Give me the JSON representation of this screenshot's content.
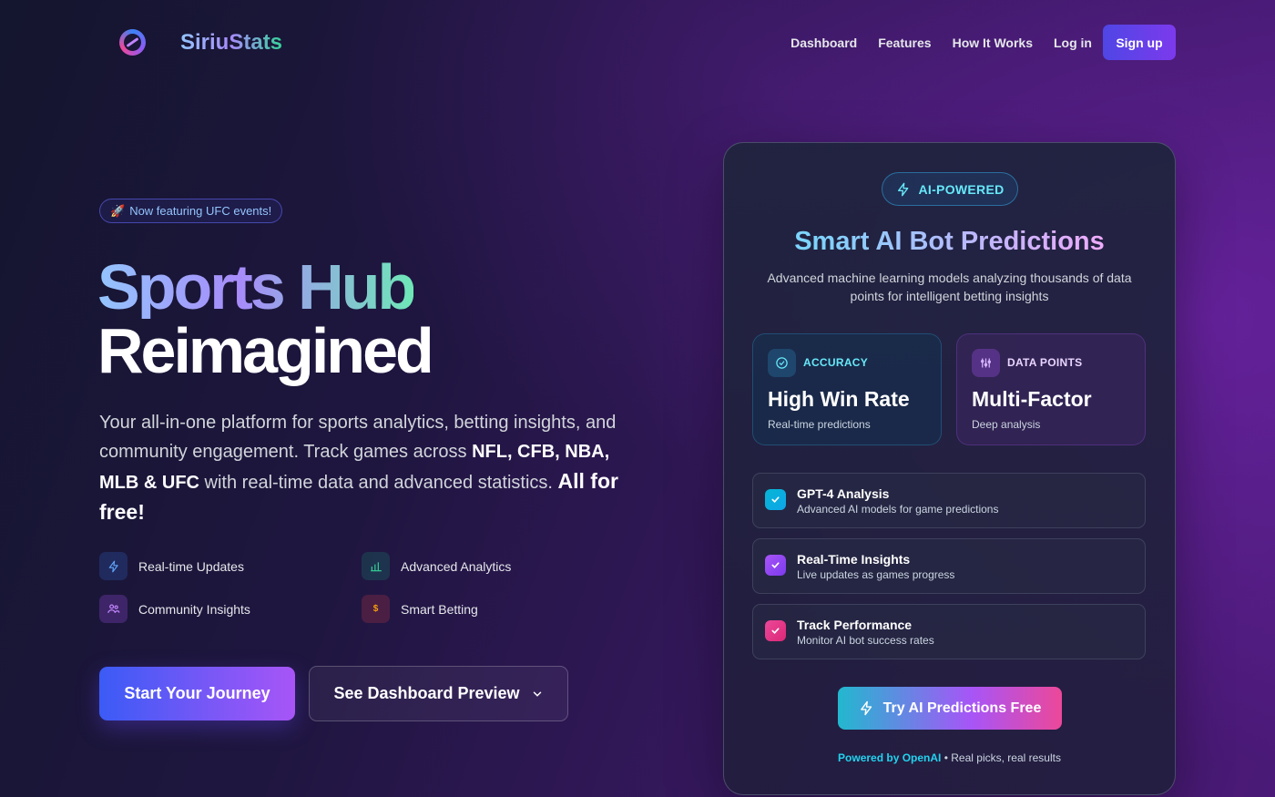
{
  "nav": {
    "brand": "SiriuStats",
    "links": [
      "Dashboard",
      "Features",
      "How It Works",
      "Log in"
    ],
    "signup": "Sign up"
  },
  "hero": {
    "badge_icon": "rocket-icon",
    "badge": "Now featuring UFC events!",
    "title_line1": "Sports Hub",
    "title_line2": "Reimagined",
    "desc_1": "Your all-in-one platform for sports analytics, betting insights, and community engagement. Track games across ",
    "desc_bold": "NFL, CFB, NBA, MLB & UFC",
    "desc_2": " with real-time data and advanced statistics. ",
    "desc_emph": "All for free!",
    "features": [
      {
        "label": "Real-time Updates",
        "icon": "lightning-icon"
      },
      {
        "label": "Advanced Analytics",
        "icon": "bar-chart-icon"
      },
      {
        "label": "Community Insights",
        "icon": "users-icon"
      },
      {
        "label": "Smart Betting",
        "icon": "dollar-icon"
      }
    ],
    "cta_primary": "Start Your Journey",
    "cta_secondary": "See Dashboard Preview"
  },
  "card": {
    "pill": "AI-POWERED",
    "title": "Smart AI Bot Predictions",
    "subtitle": "Advanced machine learning models analyzing thousands of data points for intelligent betting insights",
    "stats": [
      {
        "label": "ACCURACY",
        "value": "High Win Rate",
        "note": "Real-time predictions"
      },
      {
        "label": "DATA POINTS",
        "value": "Multi-Factor",
        "note": "Deep analysis"
      }
    ],
    "rows": [
      {
        "title": "GPT-4 Analysis",
        "sub": "Advanced AI models for game predictions"
      },
      {
        "title": "Real-Time Insights",
        "sub": "Live updates as games progress"
      },
      {
        "title": "Track Performance",
        "sub": "Monitor AI bot success rates"
      }
    ],
    "cta": "Try AI Predictions Free",
    "powered": "Powered by OpenAI",
    "tagline": " • Real picks, real results"
  },
  "colors": {
    "accent": "#7c3aed",
    "cyan": "#22d3ee",
    "pink": "#ec4899",
    "bg_dark": "#14152e"
  }
}
